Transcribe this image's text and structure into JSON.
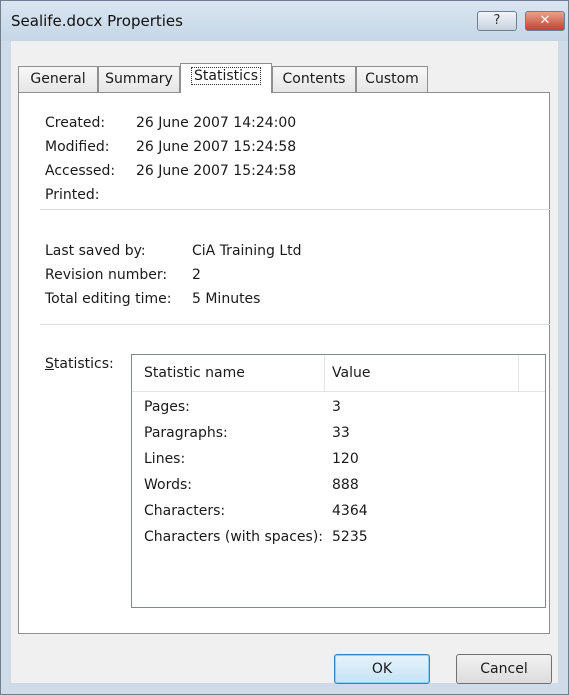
{
  "window": {
    "title": "Sealife.docx Properties",
    "help_glyph": "?",
    "close_glyph": "✕"
  },
  "tabs": [
    {
      "label": "General"
    },
    {
      "label": "Summary"
    },
    {
      "label": "Statistics"
    },
    {
      "label": "Contents"
    },
    {
      "label": "Custom"
    }
  ],
  "active_tab": "Statistics",
  "dates": {
    "created_label": "Created:",
    "created_value": "26 June 2007 14:24:00",
    "modified_label": "Modified:",
    "modified_value": "26 June 2007 15:24:58",
    "accessed_label": "Accessed:",
    "accessed_value": "26 June 2007 15:24:58",
    "printed_label": "Printed:",
    "printed_value": ""
  },
  "info": {
    "last_saved_label": "Last saved by:",
    "last_saved_value": "CiA Training Ltd",
    "revision_label": "Revision number:",
    "revision_value": "2",
    "editing_label": "Total editing time:",
    "editing_value": "5 Minutes"
  },
  "statistics": {
    "label_first": "S",
    "label_rest": "tatistics:",
    "columns": {
      "name": "Statistic name",
      "value": "Value"
    },
    "rows": [
      {
        "name": "Pages:",
        "value": "3"
      },
      {
        "name": "Paragraphs:",
        "value": "33"
      },
      {
        "name": "Lines:",
        "value": "120"
      },
      {
        "name": "Words:",
        "value": "888"
      },
      {
        "name": "Characters:",
        "value": "4364"
      },
      {
        "name": "Characters (with spaces):",
        "value": "5235"
      }
    ]
  },
  "buttons": {
    "ok": "OK",
    "cancel": "Cancel"
  },
  "colors": {
    "frame": "#cfdbe8",
    "dialog_bg": "#f0f0f0",
    "separator": "#d5dfe5",
    "close_button": "#c0442c"
  }
}
